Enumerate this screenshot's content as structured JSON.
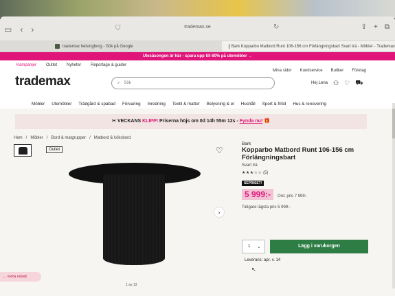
{
  "browser": {
    "url": "trademax.se",
    "tabs": [
      {
        "label": "trademax helsingborg - Sök på Google"
      },
      {
        "label": "Bark Kopparbo Matbord Runt 106-156 cm Förlängningsbart Svart trä - Möbler - Trademax"
      }
    ]
  },
  "promo_bar": "Utesäsongen är här - spara upp till 60% på utemöbler →",
  "header": {
    "topnav": [
      "Kampanjer",
      "Outlet",
      "Nyheter",
      "Reportage & guider"
    ],
    "rightnav": [
      "Mina sidor",
      "Kundservice",
      "Butiker",
      "Företag"
    ],
    "logo": "trademax",
    "search_placeholder": "Sök",
    "user": "Hej Lena"
  },
  "categories": [
    "Möbler",
    "Utemöbler",
    "Trädgård & spabad",
    "Förvaring",
    "Inredning",
    "Textil & mattor",
    "Belysning & el",
    "Hushåll",
    "Sport & fritid",
    "Hus & renovering"
  ],
  "flash": {
    "prefix": "VECKANS",
    "highlight": "KLIPP!",
    "text": "Priserna höjs om 0d 14h 55m 12s -",
    "link": "Fynda nu!"
  },
  "breadcrumb": [
    "Hem",
    "Möbler",
    "Bord & matgrupper",
    "Matbord & köksbord"
  ],
  "product": {
    "outlet_label": "Outlet",
    "brand": "Bark",
    "name": "Kopparbo Matbord Runt 106-156 cm Förlängningsbart",
    "color": "Svart trä",
    "rating": 2.5,
    "review_count": "(5)",
    "sale_tag": "SEPRISET!",
    "price": "5 999:-",
    "ord_price": "Ord. pris 7 999:-",
    "lowest_price": "Tidigare lägsta pris 5 999:-",
    "quantity": "1",
    "add_to_cart": "Lägg i varukorgen",
    "delivery": "Leverans: apr. v. 14"
  },
  "side_discount": "← extra rabatt",
  "image_pager": "1 av 13",
  "colors": {
    "brand_pink": "#e0157a",
    "cart_green": "#2e7d45"
  }
}
